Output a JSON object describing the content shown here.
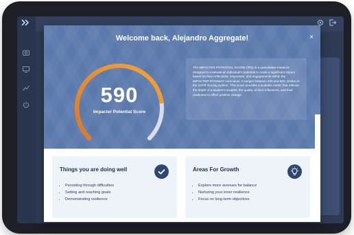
{
  "modal": {
    "title": "Welcome back, Alejandro Aggregate!",
    "close_label": "×",
    "score": {
      "value": "590",
      "label": "Impacter Potential Score",
      "fraction": 0.8
    },
    "description": "The IMPACTER POTENTIAL SCORE (IPS) is a quantitative measure designed to evaluate an individual's potential to make a significant impact based on their reflections, responses, and engagements within the IMPACTER PATHWAY curriculum. It ranges between 200 and 800, similar to the SAT® scoring system. This score provides a scalable metric that reflects the depth of a student's insights, the quality of their reflections, and their readiness to effect positive change."
  },
  "cards": {
    "doing_well": {
      "title": "Things you are doing well",
      "icon": "check-icon",
      "items": [
        "Persisting through difficulties",
        "Setting and reaching goals",
        "Demonstrating resilience"
      ]
    },
    "growth": {
      "title": "Areas For Growth",
      "icon": "lightbulb-icon",
      "items": [
        "Explore more avenues for balance",
        "Nurturing your inner resilience",
        "Focus on long-term objectives"
      ]
    }
  },
  "colors": {
    "header": "#5a79ad",
    "gauge_orange": "#f08a1e",
    "gauge_track": "#d9dde6",
    "badge": "#2c4770"
  }
}
